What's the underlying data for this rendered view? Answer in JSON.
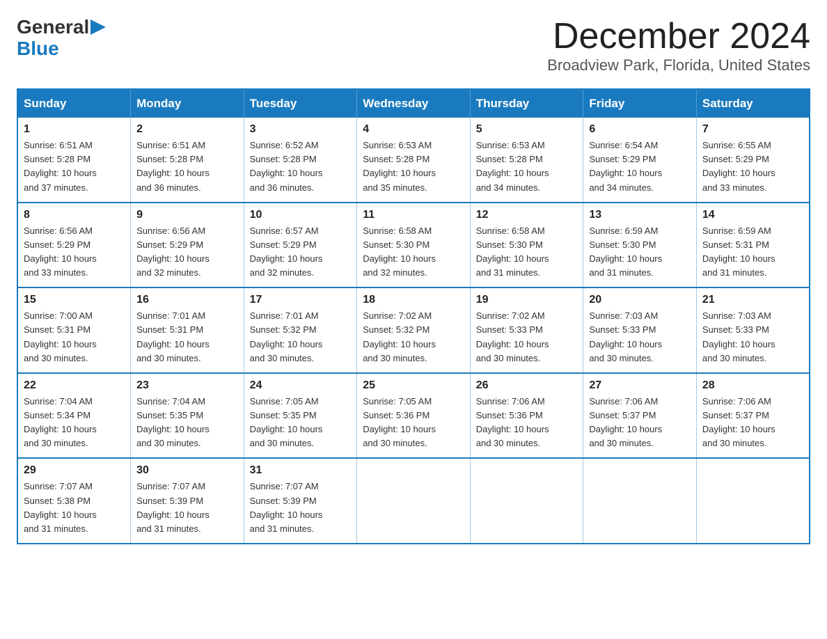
{
  "header": {
    "logo_general": "General",
    "logo_blue": "Blue",
    "month_title": "December 2024",
    "location": "Broadview Park, Florida, United States"
  },
  "weekdays": [
    "Sunday",
    "Monday",
    "Tuesday",
    "Wednesday",
    "Thursday",
    "Friday",
    "Saturday"
  ],
  "weeks": [
    [
      {
        "day": "1",
        "sunrise": "6:51 AM",
        "sunset": "5:28 PM",
        "daylight": "10 hours and 37 minutes."
      },
      {
        "day": "2",
        "sunrise": "6:51 AM",
        "sunset": "5:28 PM",
        "daylight": "10 hours and 36 minutes."
      },
      {
        "day": "3",
        "sunrise": "6:52 AM",
        "sunset": "5:28 PM",
        "daylight": "10 hours and 36 minutes."
      },
      {
        "day": "4",
        "sunrise": "6:53 AM",
        "sunset": "5:28 PM",
        "daylight": "10 hours and 35 minutes."
      },
      {
        "day": "5",
        "sunrise": "6:53 AM",
        "sunset": "5:28 PM",
        "daylight": "10 hours and 34 minutes."
      },
      {
        "day": "6",
        "sunrise": "6:54 AM",
        "sunset": "5:29 PM",
        "daylight": "10 hours and 34 minutes."
      },
      {
        "day": "7",
        "sunrise": "6:55 AM",
        "sunset": "5:29 PM",
        "daylight": "10 hours and 33 minutes."
      }
    ],
    [
      {
        "day": "8",
        "sunrise": "6:56 AM",
        "sunset": "5:29 PM",
        "daylight": "10 hours and 33 minutes."
      },
      {
        "day": "9",
        "sunrise": "6:56 AM",
        "sunset": "5:29 PM",
        "daylight": "10 hours and 32 minutes."
      },
      {
        "day": "10",
        "sunrise": "6:57 AM",
        "sunset": "5:29 PM",
        "daylight": "10 hours and 32 minutes."
      },
      {
        "day": "11",
        "sunrise": "6:58 AM",
        "sunset": "5:30 PM",
        "daylight": "10 hours and 32 minutes."
      },
      {
        "day": "12",
        "sunrise": "6:58 AM",
        "sunset": "5:30 PM",
        "daylight": "10 hours and 31 minutes."
      },
      {
        "day": "13",
        "sunrise": "6:59 AM",
        "sunset": "5:30 PM",
        "daylight": "10 hours and 31 minutes."
      },
      {
        "day": "14",
        "sunrise": "6:59 AM",
        "sunset": "5:31 PM",
        "daylight": "10 hours and 31 minutes."
      }
    ],
    [
      {
        "day": "15",
        "sunrise": "7:00 AM",
        "sunset": "5:31 PM",
        "daylight": "10 hours and 30 minutes."
      },
      {
        "day": "16",
        "sunrise": "7:01 AM",
        "sunset": "5:31 PM",
        "daylight": "10 hours and 30 minutes."
      },
      {
        "day": "17",
        "sunrise": "7:01 AM",
        "sunset": "5:32 PM",
        "daylight": "10 hours and 30 minutes."
      },
      {
        "day": "18",
        "sunrise": "7:02 AM",
        "sunset": "5:32 PM",
        "daylight": "10 hours and 30 minutes."
      },
      {
        "day": "19",
        "sunrise": "7:02 AM",
        "sunset": "5:33 PM",
        "daylight": "10 hours and 30 minutes."
      },
      {
        "day": "20",
        "sunrise": "7:03 AM",
        "sunset": "5:33 PM",
        "daylight": "10 hours and 30 minutes."
      },
      {
        "day": "21",
        "sunrise": "7:03 AM",
        "sunset": "5:33 PM",
        "daylight": "10 hours and 30 minutes."
      }
    ],
    [
      {
        "day": "22",
        "sunrise": "7:04 AM",
        "sunset": "5:34 PM",
        "daylight": "10 hours and 30 minutes."
      },
      {
        "day": "23",
        "sunrise": "7:04 AM",
        "sunset": "5:35 PM",
        "daylight": "10 hours and 30 minutes."
      },
      {
        "day": "24",
        "sunrise": "7:05 AM",
        "sunset": "5:35 PM",
        "daylight": "10 hours and 30 minutes."
      },
      {
        "day": "25",
        "sunrise": "7:05 AM",
        "sunset": "5:36 PM",
        "daylight": "10 hours and 30 minutes."
      },
      {
        "day": "26",
        "sunrise": "7:06 AM",
        "sunset": "5:36 PM",
        "daylight": "10 hours and 30 minutes."
      },
      {
        "day": "27",
        "sunrise": "7:06 AM",
        "sunset": "5:37 PM",
        "daylight": "10 hours and 30 minutes."
      },
      {
        "day": "28",
        "sunrise": "7:06 AM",
        "sunset": "5:37 PM",
        "daylight": "10 hours and 30 minutes."
      }
    ],
    [
      {
        "day": "29",
        "sunrise": "7:07 AM",
        "sunset": "5:38 PM",
        "daylight": "10 hours and 31 minutes."
      },
      {
        "day": "30",
        "sunrise": "7:07 AM",
        "sunset": "5:39 PM",
        "daylight": "10 hours and 31 minutes."
      },
      {
        "day": "31",
        "sunrise": "7:07 AM",
        "sunset": "5:39 PM",
        "daylight": "10 hours and 31 minutes."
      },
      null,
      null,
      null,
      null
    ]
  ],
  "labels": {
    "sunrise": "Sunrise:",
    "sunset": "Sunset:",
    "daylight": "Daylight:"
  }
}
